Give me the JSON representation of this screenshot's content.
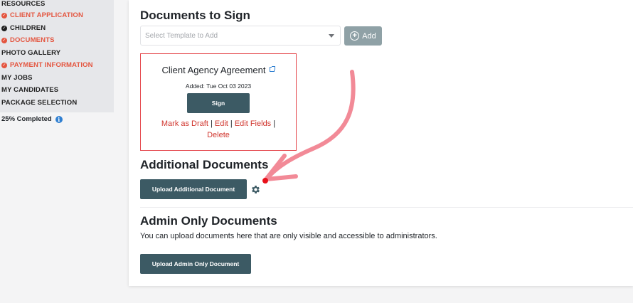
{
  "sidebar": {
    "items": [
      {
        "label": "RESOURCES",
        "status": "none"
      },
      {
        "label": "CLIENT APPLICATION",
        "status": "alert"
      },
      {
        "label": "CHILDREN",
        "status": "done"
      },
      {
        "label": "DOCUMENTS",
        "status": "alert"
      },
      {
        "label": "PHOTO GALLERY",
        "status": "none"
      },
      {
        "label": "PAYMENT INFORMATION",
        "status": "alert"
      },
      {
        "label": "MY JOBS",
        "status": "none"
      },
      {
        "label": "MY CANDIDATES",
        "status": "none"
      },
      {
        "label": "PACKAGE SELECTION",
        "status": "none"
      }
    ],
    "progress_label": "25% Completed",
    "info_glyph": "i"
  },
  "sign_section": {
    "title": "Documents to Sign",
    "template_select": {
      "placeholder": "Select Template to Add"
    },
    "add_label": "Add",
    "document": {
      "title": "Client Agency Agreement",
      "added": "Added: Tue Oct 03 2023",
      "sign_label": "Sign",
      "links": {
        "mark_draft": "Mark as Draft",
        "edit": "Edit",
        "edit_fields": "Edit Fields",
        "delete": "Delete",
        "separator": "|"
      }
    }
  },
  "additional_section": {
    "title": "Additional Documents",
    "upload_label": "Upload Additional Document"
  },
  "admin_section": {
    "title": "Admin Only Documents",
    "description": "You can upload documents here that are only visible and accessible to administrators.",
    "upload_label": "Upload Admin Only Document"
  },
  "colors": {
    "alert": "#e4553f",
    "button_dark": "#3c5a64",
    "button_muted": "#8fa1a6",
    "card_border": "#e5484d",
    "arrow": "#f28a97",
    "marker": "#e8101a",
    "info": "#2f7fd1"
  },
  "icons": {
    "check": "check-icon",
    "external_link": "external-link-icon",
    "plus": "plus-circle-icon",
    "gear": "gear-icon",
    "info": "info-icon",
    "caret": "caret-down-icon"
  }
}
